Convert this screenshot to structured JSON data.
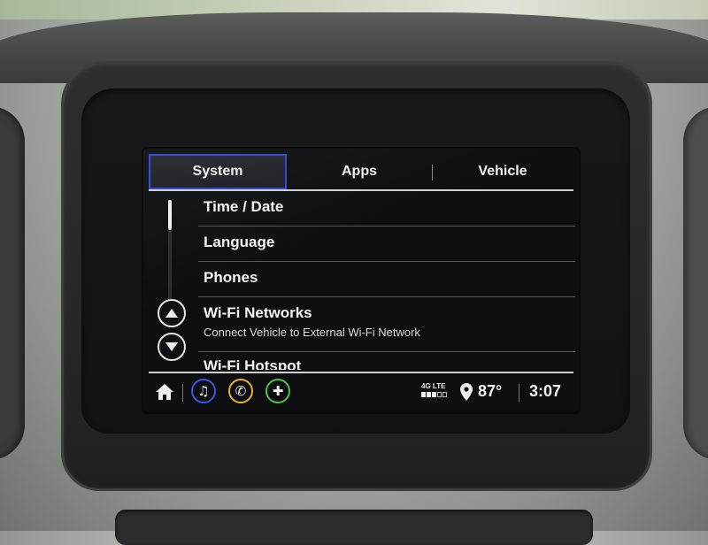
{
  "tabs": [
    {
      "label": "System",
      "active": true
    },
    {
      "label": "Apps",
      "active": false
    },
    {
      "label": "Vehicle",
      "active": false
    }
  ],
  "list": {
    "items": [
      {
        "label": "Time / Date"
      },
      {
        "label": "Language"
      },
      {
        "label": "Phones"
      },
      {
        "label": "Wi-Fi Networks",
        "subtitle": "Connect Vehicle to External Wi-Fi Network"
      },
      {
        "label": "Wi-Fi Hotspot"
      }
    ]
  },
  "status": {
    "network": "4G LTE",
    "signal_bars_filled": 3,
    "signal_bars_total": 5,
    "temperature": "87°",
    "time": "3:07"
  },
  "bottom_bar": {
    "icons": [
      "home-icon",
      "music-note-icon",
      "phone-icon",
      "navigation-icon",
      "location-pin-icon"
    ]
  },
  "colors": {
    "active_tab_border": "#2f45d8",
    "music_ring": "#3a55e0",
    "phone_ring": "#e8b12a",
    "nav_ring": "#4fc24b"
  }
}
